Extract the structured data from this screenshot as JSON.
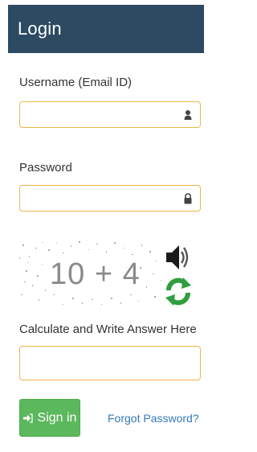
{
  "header": {
    "title": "Login"
  },
  "username": {
    "label": "Username (Email ID)",
    "value": "",
    "icon": "user-icon"
  },
  "password": {
    "label": "Password",
    "value": "",
    "icon": "lock-icon"
  },
  "captcha": {
    "text": "10 + 4",
    "answer_label": "Calculate and Write Answer Here",
    "answer_value": "",
    "sound_icon": "speaker-icon",
    "refresh_icon": "refresh-icon"
  },
  "actions": {
    "signin_label": "Sign in",
    "signin_icon": "sign-in-icon",
    "forgot_label": "Forgot Password?"
  },
  "colors": {
    "header_bg": "#2d4a63",
    "input_border": "#f0b54a",
    "signin_bg": "#5cb85c",
    "link": "#337ab7"
  }
}
